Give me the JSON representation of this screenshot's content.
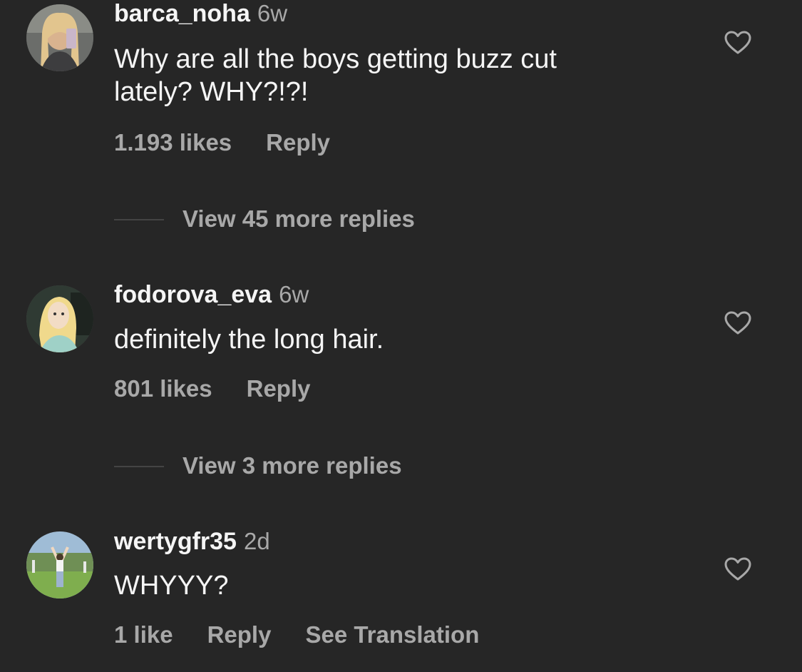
{
  "comments": [
    {
      "username": "barca_noha",
      "time": "6w",
      "text_lines": [
        "Why are all the boys getting buzz cut",
        "lately? WHY?!?!"
      ],
      "likes": "1.193 likes",
      "reply": "Reply",
      "view_replies": "View 45 more replies",
      "avatar": "selfie-avatar"
    },
    {
      "username": "fodorova_eva",
      "time": "6w",
      "text_lines": [
        "definitely the long hair."
      ],
      "likes": "801 likes",
      "reply": "Reply",
      "view_replies": "View 3 more replies",
      "avatar": "cartoon-princess-avatar"
    },
    {
      "username": "wertygfr35",
      "time": "2d",
      "text_lines": [
        "WHYYY?"
      ],
      "likes": "1 like",
      "reply": "Reply",
      "see_translation": "See Translation",
      "avatar": "outdoor-person-avatar"
    }
  ],
  "icons": {
    "like": "heart-icon"
  },
  "colors": {
    "background": "#262626",
    "primary_text": "#f5f5f5",
    "secondary_text": "#a8a8a8"
  }
}
